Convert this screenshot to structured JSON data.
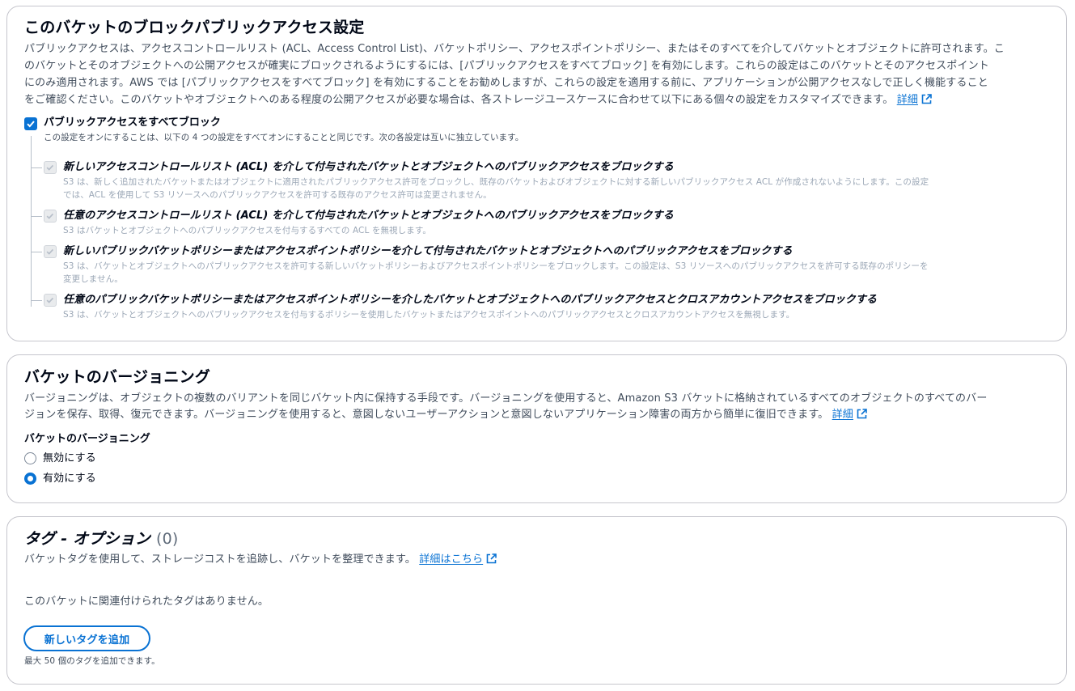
{
  "block_public_access": {
    "title": "このバケットのブロックパブリックアクセス設定",
    "description_lines": [
      "パブリックアクセスは、アクセスコントロールリスト (ACL、Access Control List)、バケットポリシー、アクセスポイントポリシー、またはそのすべてを介してバケットとオブジェクトに許可されます。こ",
      "のバケットとそのオブジェクトへの公開アクセスが確実にブロックされるようにするには、[パブリックアクセスをすべてブロック] を有効にします。これらの設定はこのバケットとそのアクセスポイント",
      "にのみ適用されます。AWS では [パブリックアクセスをすべてブロック] を有効にすることをお勧めしますが、これらの設定を適用する前に、アプリケーションが公開アクセスなしで正しく機能すること",
      "をご確認ください。このバケットやオブジェクトへのある程度の公開アクセスが必要な場合は、各ストレージユースケースに合わせて以下にある個々の設定をカスタマイズできます。"
    ],
    "learn_more": "詳細",
    "block_all": {
      "label": "パブリックアクセスをすべてブロック",
      "description": "この設定をオンにすることは、以下の 4 つの設定をすべてオンにすることと同じです。次の各設定は互いに独立しています。",
      "checked": true
    },
    "options": [
      {
        "title": "新しいアクセスコントロールリスト (ACL) を介して付与されたバケットとオブジェクトへのパブリックアクセスをブロックする",
        "desc_lines": [
          "S3 は、新しく追加されたバケットまたはオブジェクトに適用されたパブリックアクセス許可をブロックし、既存のバケットおよびオブジェクトに対する新しいパブリックアクセス ACL が作成されないようにします。この設定",
          "では、ACL を使用して S3 リソースへのパブリックアクセスを許可する既存のアクセス許可は変更されません。"
        ],
        "checked": true
      },
      {
        "title": "任意のアクセスコントロールリスト (ACL) を介して付与されたバケットとオブジェクトへのパブリックアクセスをブロックする",
        "desc_lines": [
          "S3 はバケットとオブジェクトへのパブリックアクセスを付与するすべての ACL を無視します。"
        ],
        "checked": true
      },
      {
        "title": "新しいパブリックバケットポリシーまたはアクセスポイントポリシーを介して付与されたバケットとオブジェクトへのパブリックアクセスをブロックする",
        "desc_lines": [
          "S3 は、バケットとオブジェクトへのパブリックアクセスを許可する新しいバケットポリシーおよびアクセスポイントポリシーをブロックします。この設定は、S3 リソースへのパブリックアクセスを許可する既存のポリシーを",
          "変更しません。"
        ],
        "checked": true
      },
      {
        "title": "任意のパブリックバケットポリシーまたはアクセスポイントポリシーを介したバケットとオブジェクトへのパブリックアクセスとクロスアカウントアクセスをブロックする",
        "desc_lines": [
          "S3 は、バケットとオブジェクトへのパブリックアクセスを付与するポリシーを使用したバケットまたはアクセスポイントへのパブリックアクセスとクロスアカウントアクセスを無視します。"
        ],
        "checked": true
      }
    ]
  },
  "versioning": {
    "title": "バケットのバージョニング",
    "description_lines": [
      "バージョニングは、オブジェクトの複数のバリアントを同じバケット内に保持する手段です。バージョニングを使用すると、Amazon S3 バケットに格納されているすべてのオブジェクトのすべてのバー",
      "ジョンを保存、取得、復元できます。バージョニングを使用すると、意図しないユーザーアクションと意図しないアプリケーション障害の両方から簡単に復旧できます。"
    ],
    "learn_more": "詳細",
    "field_label": "バケットのバージョニング",
    "options": [
      {
        "label": "無効にする",
        "selected": false
      },
      {
        "label": "有効にする",
        "selected": true
      }
    ]
  },
  "tags": {
    "title": "タグ - オプション",
    "count": "(0)",
    "description": "バケットタグを使用して、ストレージコストを追跡し、バケットを整理できます。",
    "learn_more": "詳細はこちら",
    "empty_message": "このバケットに関連付けられたタグはありません。",
    "add_button": "新しいタグを追加",
    "limit_note": "最大 50 個のタグを追加できます。"
  },
  "colors": {
    "accent": "#0972d3",
    "text": "#000716",
    "secondary_text": "#414d5c",
    "disabled_text": "#9ba7b6",
    "border": "#c6c6cd"
  }
}
